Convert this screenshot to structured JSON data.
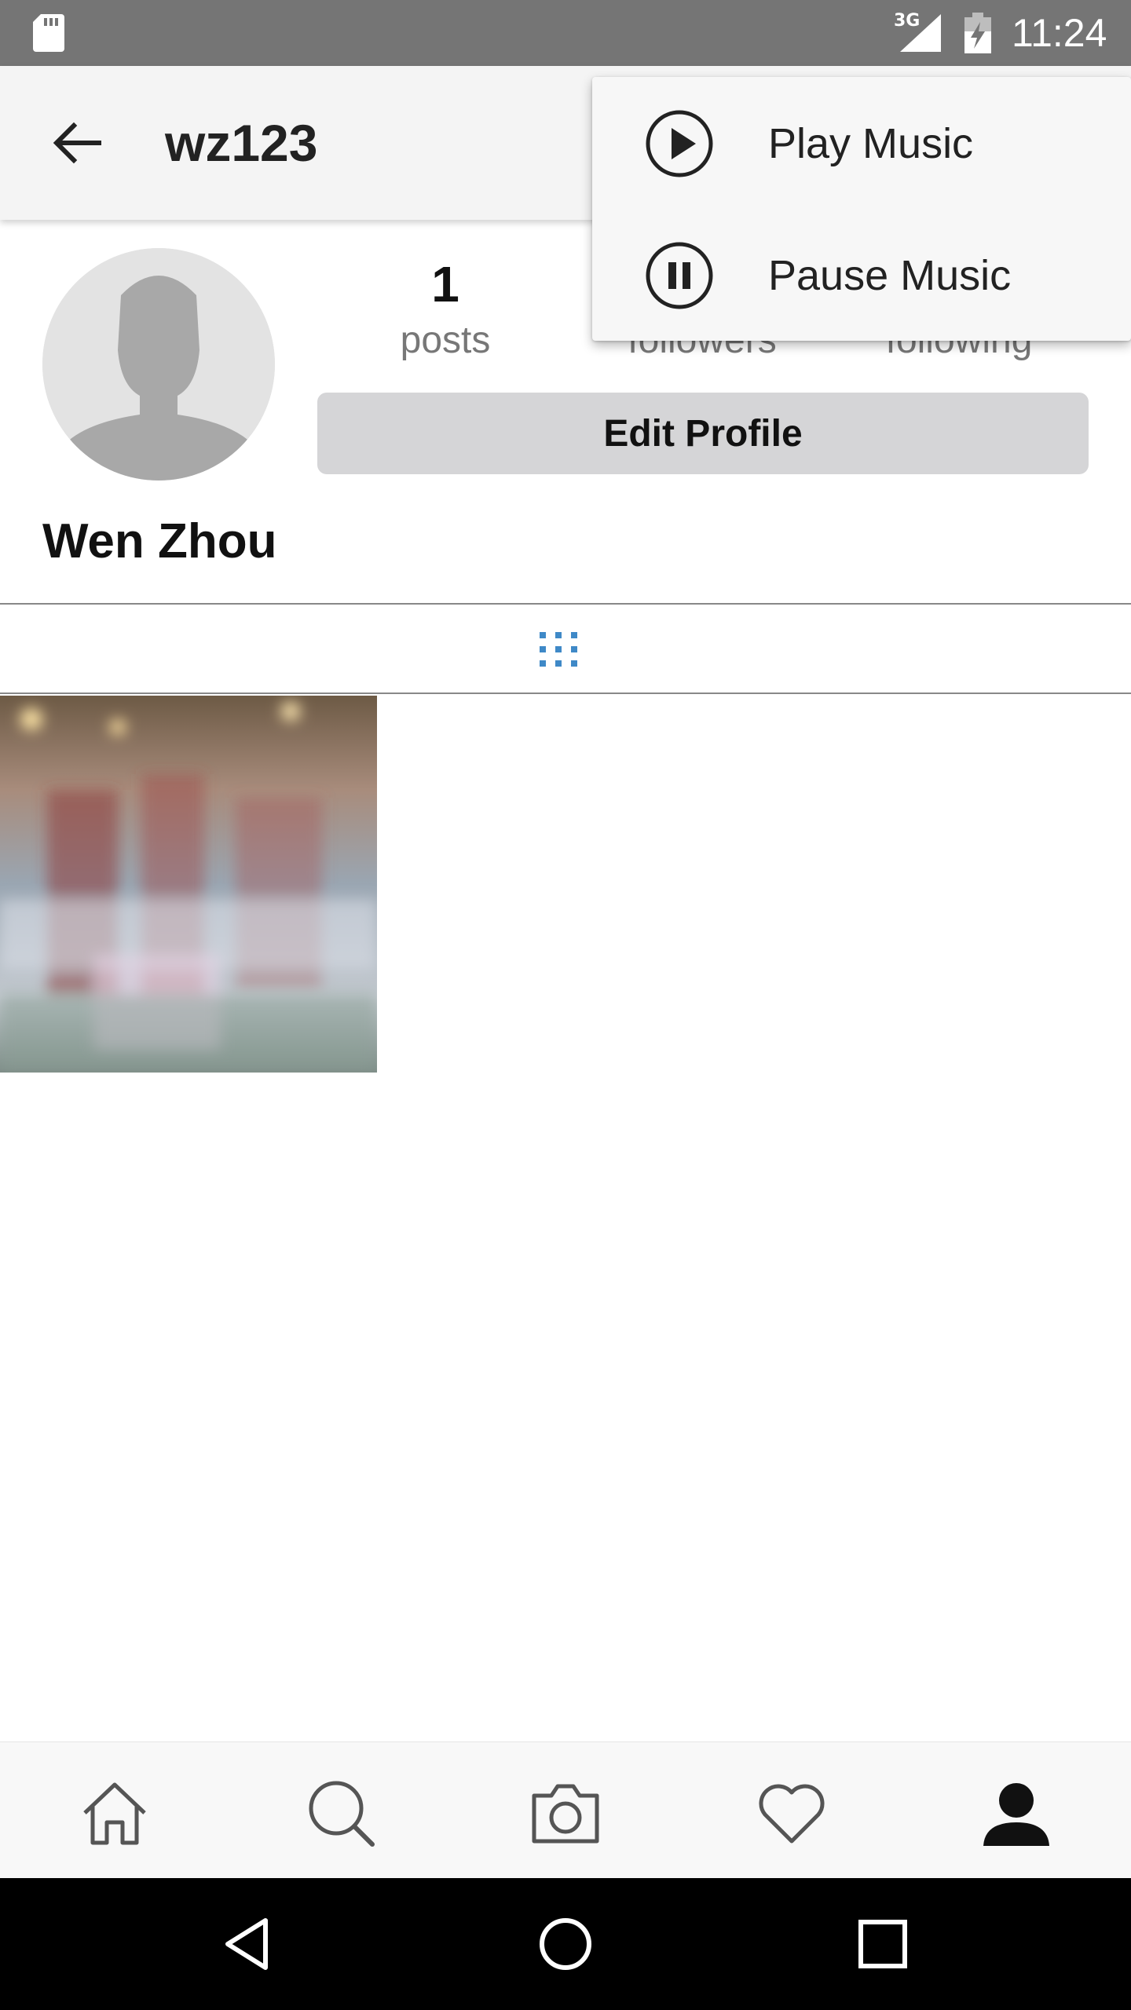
{
  "status_bar": {
    "network": "3G",
    "time": "11:24",
    "icons": [
      "sd-card-icon",
      "signal-icon",
      "battery-charging-icon"
    ]
  },
  "app_bar": {
    "back_icon": "arrow-left-icon",
    "username": "wz123"
  },
  "profile": {
    "avatar_icon": "default-avatar-icon",
    "stats": {
      "posts_count": "1",
      "posts_label": "posts",
      "followers_label": "followers",
      "following_label": "following"
    },
    "edit_label": "Edit Profile",
    "display_name": "Wen Zhou"
  },
  "grid_tab": {
    "icon": "grid-icon",
    "accent": "#3f89c7"
  },
  "posts": [
    {
      "thumbnail": "photo-thumbnail"
    }
  ],
  "menu": {
    "items": [
      {
        "label": "Play Music",
        "icon": "play-circle-icon"
      },
      {
        "label": "Pause Music",
        "icon": "pause-circle-icon"
      }
    ]
  },
  "bottom_nav": {
    "items": [
      "home-icon",
      "search-icon",
      "camera-icon",
      "heart-icon",
      "profile-icon"
    ],
    "active": "profile-icon"
  },
  "system_nav": {
    "items": [
      "back-triangle-icon",
      "home-circle-icon",
      "recents-square-icon"
    ]
  }
}
